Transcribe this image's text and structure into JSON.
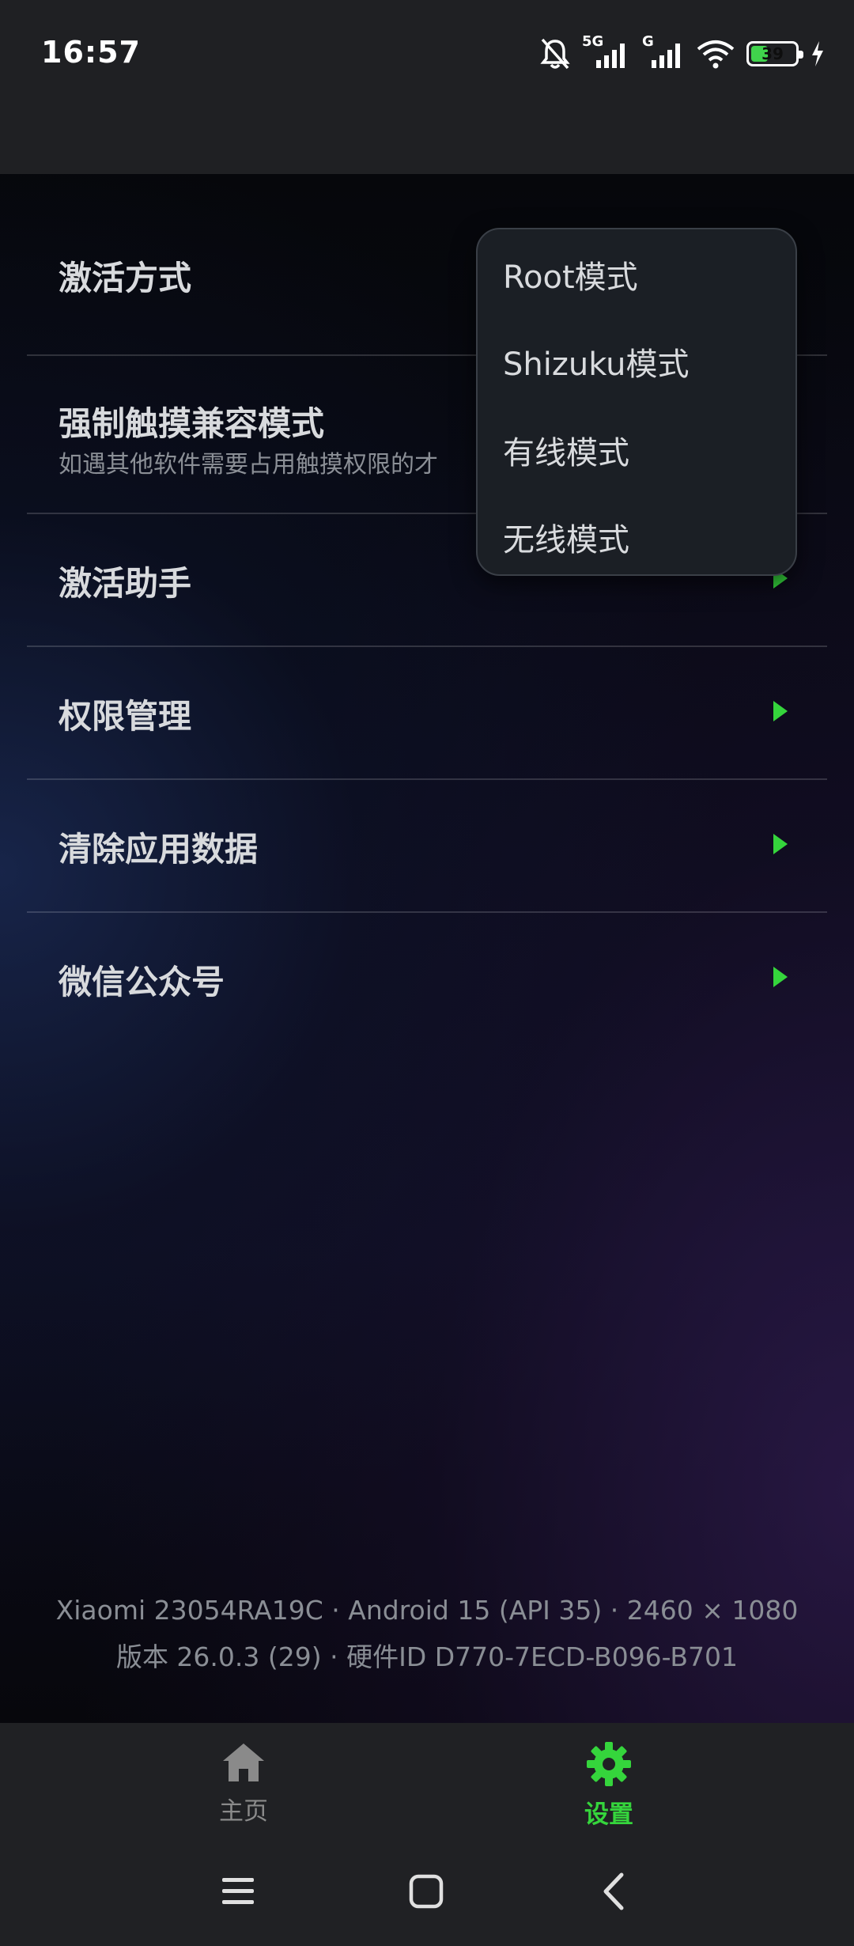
{
  "status_bar": {
    "time": "16:57",
    "network_label_1": "5G",
    "network_label_2": "G",
    "battery_level": "39",
    "battery_fraction": 0.39,
    "icons": [
      "mute-bell-icon",
      "signal-5g-icon",
      "signal-g-icon",
      "wifi-icon",
      "battery-icon",
      "charging-bolt-icon"
    ]
  },
  "settings": {
    "rows": [
      {
        "label": "激活方式"
      },
      {
        "label": "强制触摸兼容模式",
        "sub": "如遇其他软件需要占用触摸权限的才"
      },
      {
        "label": "激活助手"
      },
      {
        "label": "权限管理"
      },
      {
        "label": "清除应用数据"
      },
      {
        "label": "微信公众号"
      }
    ]
  },
  "dropdown": {
    "options": [
      "Root模式",
      "Shizuku模式",
      "有线模式",
      "无线模式"
    ]
  },
  "device_info": {
    "line1": "Xiaomi 23054RA19C · Android 15 (API 35) · 2460 × 1080",
    "line2": "版本 26.0.3 (29) · 硬件ID D770-7ECD-B096-B701"
  },
  "bottom_nav": {
    "tabs": [
      {
        "label": "主页",
        "icon": "home-icon",
        "active": false
      },
      {
        "label": "设置",
        "icon": "gear-icon",
        "active": true
      }
    ]
  },
  "colors": {
    "accent": "#35d53c",
    "inactive": "#8a8a8a",
    "background": "#000000",
    "nav_background": "#202124"
  }
}
